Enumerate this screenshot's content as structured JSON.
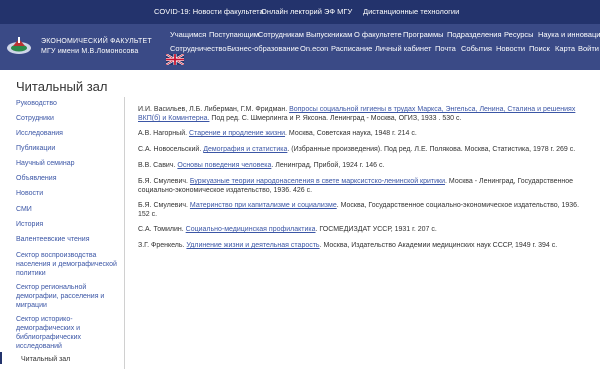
{
  "topbar": {
    "links": [
      "COVID-19: Новости факультета",
      "Онлайн лекторий ЭФ МГУ",
      "Дистанционные технологии"
    ]
  },
  "header": {
    "faculty_line1": "ЭКОНОМИЧЕСКИЙ ФАКУЛЬТЕТ",
    "faculty_line2": "МГУ имени М.В.Ломоносова",
    "nav_row1": [
      "Учащимся",
      "Поступающим",
      "Сотрудникам",
      "Выпускникам",
      "О факультете",
      "Программы",
      "Подразделения",
      "Ресурсы",
      "Наука и инновации"
    ],
    "nav_row2": [
      "Сотрудничество",
      "Бизнес-образование",
      "On.econ",
      "Расписание",
      "Личный кабинет",
      "Почта",
      "События",
      "Новости",
      "Поиск",
      "Карта",
      "Войти"
    ]
  },
  "page": {
    "title": "Читальный зал"
  },
  "sidebar": {
    "items": [
      "Руководство",
      "Сотрудники",
      "Исследования",
      "Публикации",
      "Научный семинар",
      "Объявления",
      "Новости",
      "СМИ",
      "История",
      "Валентеевские чтения",
      "Сектор воспроизводства населения и демографической политики",
      "Сектор региональной демографии, расселения и миграции",
      "Сектор историко-демографических и библиографических исследований",
      "Читальный зал"
    ]
  },
  "references": [
    {
      "pre": "И.И. Васильев, Л.Б. Либерман, Г.М. Фридман. ",
      "link": "Вопросы социальной гигиены в трудах Маркса, Энгельса, Ленина, Сталина и решениях ВКП(б) и Коминтерна.",
      "post": " Под ред. С. Шмерлинга и Р. Яксона. Ленинград - Москва, ОГИЗ, 1933 . 530 с."
    },
    {
      "pre": "А.В. Нагорный. ",
      "link": "Старение и продление жизни",
      "post": ". Москва, Советская наука, 1948 г. 214 с."
    },
    {
      "pre": "С.А. Новосельский. ",
      "link": "Демография и статистика",
      "post": ". (Избранные произведения). Под ред. Л.Е. Полякова. Москва, Статистика, 1978 г. 269 с."
    },
    {
      "pre": "В.В. Савич. ",
      "link": "Основы поведения человека",
      "post": ". Ленинград, Прибой, 1924 г. 146 с."
    },
    {
      "pre": "Б.Я. Смулевич. ",
      "link": "Буржуазные теории народонаселения в свете марксистско-ленинской критики",
      "post": ". Москва - Ленинград, Государственное социально-экономическое издательство, 1936. 426 с."
    },
    {
      "pre": "Б.Я. Смулевич. ",
      "link": "Материнство при капитализме и социализме",
      "post": ". Москва, Государственное социально-экономическое издательство, 1936. 152 с."
    },
    {
      "pre": "С.А. Томилин. ",
      "link": "Социально-медицинская профилактика",
      "post": ". ГОСМЕДИЗДАТ УССР, 1931 г. 207 с."
    },
    {
      "pre": "З.Г. Френкель. ",
      "link": "Удлинение жизни и деятельная старость",
      "post": ". Москва, Издательство Академии медицинских наук СССР, 1949 г. 394 с."
    }
  ],
  "colors": {
    "topbar": "#23336c",
    "header": "#3a4a86",
    "link": "#3b56a6"
  }
}
